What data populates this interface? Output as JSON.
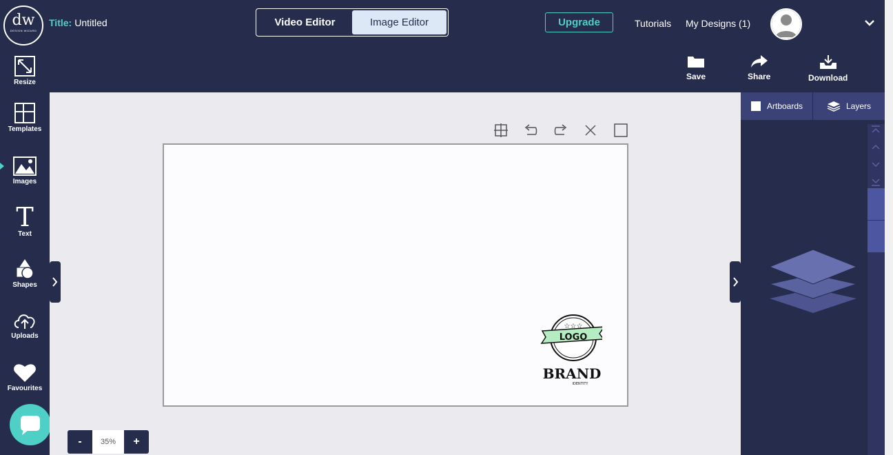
{
  "topbar": {
    "logo_text": "dw",
    "logo_subtext": "DESIGN WIZARD",
    "title_label": "Title:",
    "title_value": "Untitled",
    "editor_tabs": [
      "Video Editor",
      "Image Editor"
    ],
    "active_tab": "Image Editor",
    "upgrade_label": "Upgrade",
    "tutorials_label": "Tutorials",
    "my_designs_label": "My Designs (1)"
  },
  "sidebar": {
    "items": [
      {
        "label": "Resize",
        "icon": "resize-icon"
      },
      {
        "label": "Templates",
        "icon": "templates-icon"
      },
      {
        "label": "Images",
        "icon": "images-icon"
      },
      {
        "label": "Text",
        "icon": "text-icon"
      },
      {
        "label": "Shapes",
        "icon": "shapes-icon"
      },
      {
        "label": "Uploads",
        "icon": "uploads-icon"
      },
      {
        "label": "Favourites",
        "icon": "heart-icon"
      }
    ]
  },
  "toolbar": {
    "save_label": "Save",
    "share_label": "Share",
    "download_label": "Download"
  },
  "canvas": {
    "zoom_value": "35%",
    "zoom_minus": "-",
    "zoom_plus": "+",
    "logo_word": "LOGO",
    "brand_word": "BRAND",
    "identity_word": "IDENTITY"
  },
  "right_panel": {
    "tabs": [
      "Artboards",
      "Layers"
    ]
  },
  "colors": {
    "navy": "#262c4c",
    "accent": "#4fd0c6",
    "panel": "#3a4277",
    "scroll_block": "#4d57a1"
  }
}
